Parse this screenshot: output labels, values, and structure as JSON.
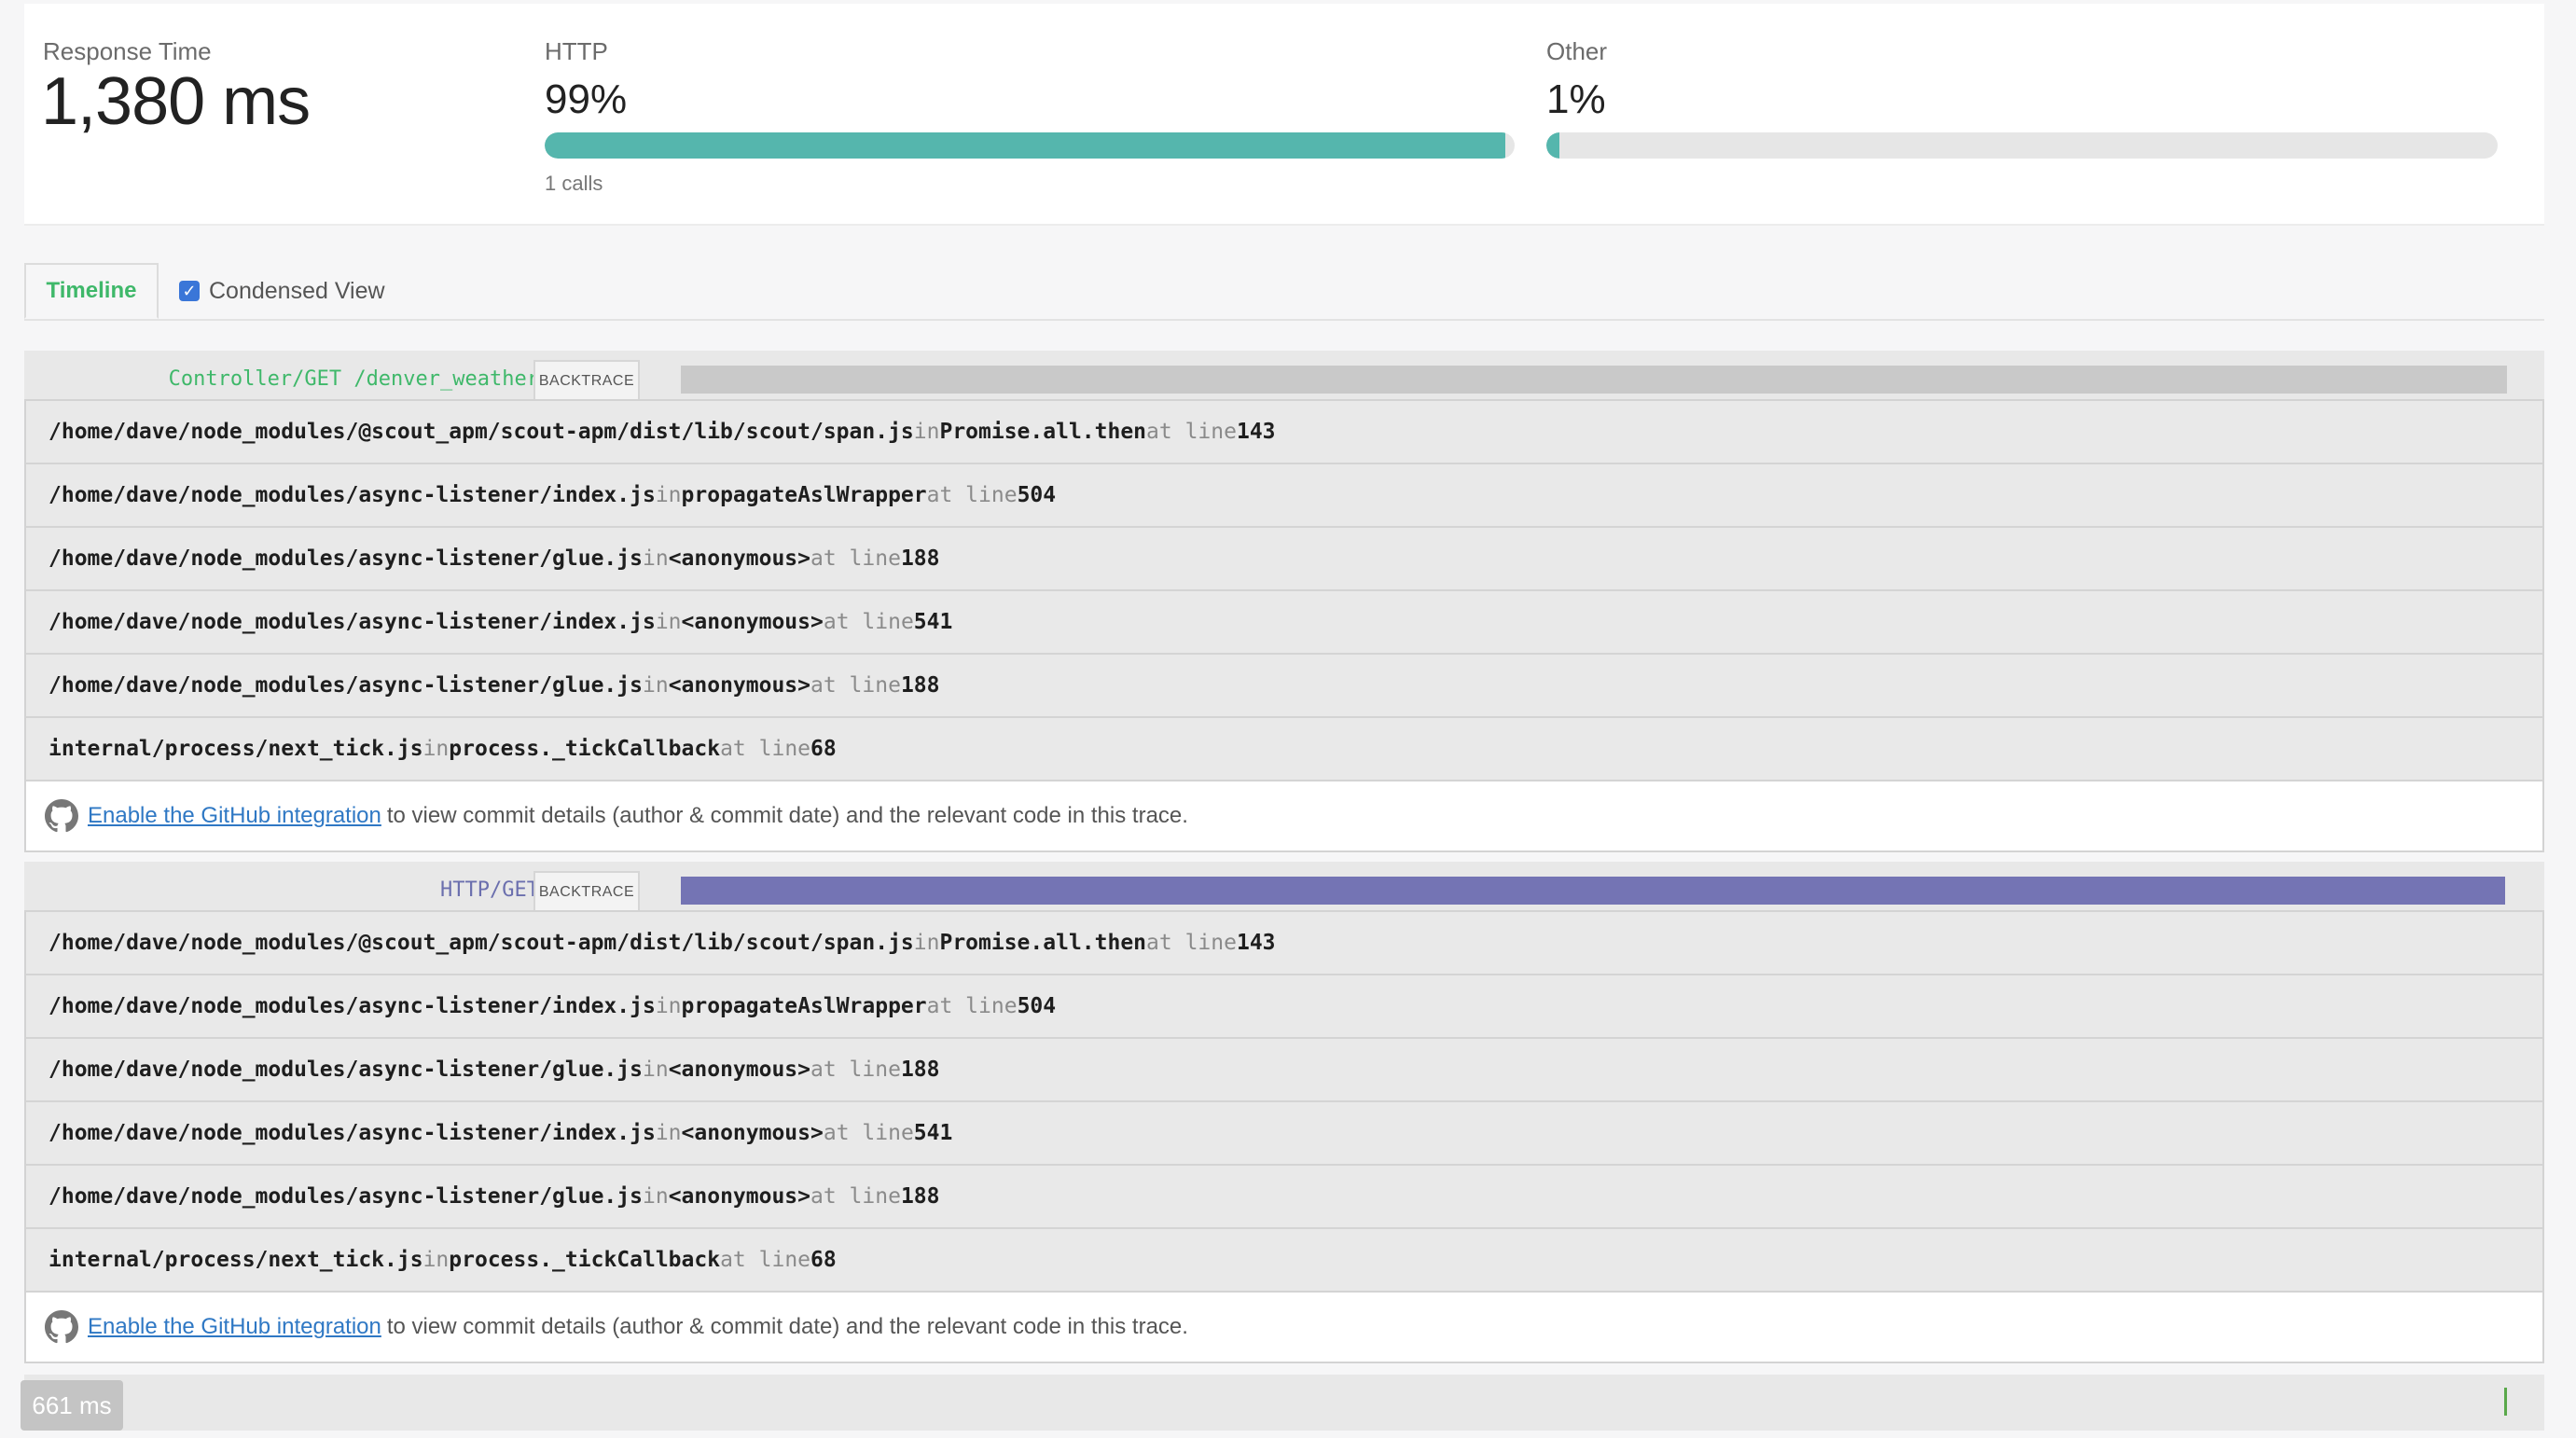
{
  "summary": {
    "response_time": {
      "label": "Response Time",
      "value": "1,380 ms"
    },
    "http": {
      "label": "HTTP",
      "value": "99%",
      "fill": 0.99,
      "calls": "1 calls"
    },
    "other": {
      "label": "Other",
      "value": "1%",
      "fill": 0.01
    }
  },
  "tabs": {
    "timeline": "Timeline",
    "condensed_view": "Condensed View",
    "condensed_checked": true
  },
  "sections": [
    {
      "name": "Controller/GET /denver_weather",
      "name_color": "#3fb86a",
      "backtrace_label": "BACKTRACE",
      "bar_color": "#c9c9c9",
      "frames": [
        {
          "file": "/home/dave/node_modules/@scout_apm/scout-apm/dist/lib/scout/span.js",
          "in": "in",
          "func": "Promise.all.then",
          "at": "at line",
          "line": "143"
        },
        {
          "file": "/home/dave/node_modules/async-listener/index.js",
          "in": "in",
          "func": "propagateAslWrapper",
          "at": "at line",
          "line": "504"
        },
        {
          "file": "/home/dave/node_modules/async-listener/glue.js",
          "in": "in",
          "func": "<anonymous>",
          "at": "at line",
          "line": "188"
        },
        {
          "file": "/home/dave/node_modules/async-listener/index.js",
          "in": "in",
          "func": "<anonymous>",
          "at": "at line",
          "line": "541"
        },
        {
          "file": "/home/dave/node_modules/async-listener/glue.js",
          "in": "in",
          "func": "<anonymous>",
          "at": "at line",
          "line": "188"
        },
        {
          "file": "internal/process/next_tick.js",
          "in": "in",
          "func": "process._tickCallback",
          "at": "at line",
          "line": "68"
        }
      ],
      "github": {
        "link": "Enable the GitHub integration",
        "rest": "to view commit details (author & commit date) and the relevant code in this trace."
      }
    },
    {
      "name": "HTTP/GET",
      "name_color": "#6b6fae",
      "backtrace_label": "BACKTRACE",
      "bar_color": "#7474b4",
      "frames": [
        {
          "file": "/home/dave/node_modules/@scout_apm/scout-apm/dist/lib/scout/span.js",
          "in": "in",
          "func": "Promise.all.then",
          "at": "at line",
          "line": "143"
        },
        {
          "file": "/home/dave/node_modules/async-listener/index.js",
          "in": "in",
          "func": "propagateAslWrapper",
          "at": "at line",
          "line": "504"
        },
        {
          "file": "/home/dave/node_modules/async-listener/glue.js",
          "in": "in",
          "func": "<anonymous>",
          "at": "at line",
          "line": "188"
        },
        {
          "file": "/home/dave/node_modules/async-listener/index.js",
          "in": "in",
          "func": "<anonymous>",
          "at": "at line",
          "line": "541"
        },
        {
          "file": "/home/dave/node_modules/async-listener/glue.js",
          "in": "in",
          "func": "<anonymous>",
          "at": "at line",
          "line": "188"
        },
        {
          "file": "internal/process/next_tick.js",
          "in": "in",
          "func": "process._tickCallback",
          "at": "at line",
          "line": "68"
        }
      ],
      "github": {
        "link": "Enable the GitHub integration",
        "rest": "to view commit details (author & commit date) and the relevant code in this trace."
      }
    }
  ],
  "footer": {
    "ms_badge": "661 ms"
  }
}
